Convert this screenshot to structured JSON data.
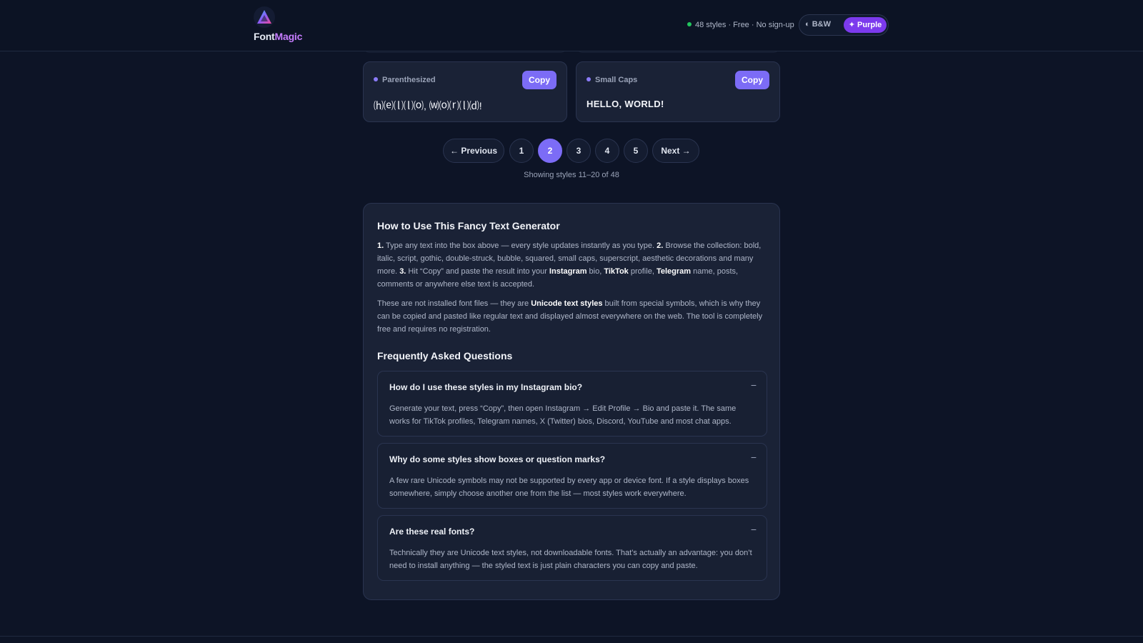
{
  "header": {
    "logo_font": "Font",
    "logo_magic": "Magic",
    "stats": "48 styles · Free · No sign-up",
    "theme_bw": "◐ B&W",
    "theme_purple": "✦ Purple"
  },
  "cards": [
    {
      "label": "Parenthesized",
      "output": "⒣⒠⒧⒧⒪, ⒲⒪⒭⒧⒟!",
      "copy": "Copy"
    },
    {
      "label": "Small Caps",
      "output": "HELLO, WORLD!",
      "copy": "Copy"
    }
  ],
  "pagination": {
    "previous": "← Previous",
    "next": "Next →",
    "pages": [
      "1",
      "2",
      "3",
      "4",
      "5"
    ],
    "active_page": "2",
    "info": "Showing styles 11–20 of 48"
  },
  "howto": {
    "title": "How to Use This Fancy Text Generator",
    "p1": [
      {
        "t": "1.",
        "b": true
      },
      {
        "t": " Type any text into the box above — every style updates instantly as you type. "
      },
      {
        "t": "2.",
        "b": true
      },
      {
        "t": " Browse the collection: bold, italic, script, gothic, double-struck, bubble, squared, small caps, superscript, aesthetic decorations and many more. "
      },
      {
        "t": "3.",
        "b": true
      },
      {
        "t": " Hit “Copy” and paste the result into your "
      },
      {
        "t": "Instagram",
        "b": true
      },
      {
        "t": " bio, "
      },
      {
        "t": "TikTok",
        "b": true
      },
      {
        "t": " profile, "
      },
      {
        "t": "Telegram",
        "b": true
      },
      {
        "t": " name, posts, comments or anywhere else text is accepted."
      }
    ],
    "p2": [
      {
        "t": "These are not installed font files — they are "
      },
      {
        "t": "Unicode text styles",
        "b": true
      },
      {
        "t": " built from special symbols, which is why they can be copied and pasted like regular text and displayed almost everywhere on the web. The tool is completely free and requires no registration."
      }
    ]
  },
  "faq": {
    "title": "Frequently Asked Questions",
    "toggle": "−",
    "items": [
      {
        "q": "How do I use these styles in my Instagram bio?",
        "a": "Generate your text, press “Copy”, then open Instagram → Edit Profile → Bio and paste it. The same works for TikTok profiles, Telegram names, X (Twitter) bios, Discord, YouTube and most chat apps."
      },
      {
        "q": "Why do some styles show boxes or question marks?",
        "a": "A few rare Unicode symbols may not be supported by every app or device font. If a style displays boxes somewhere, simply choose another one from the list — most styles work everywhere."
      },
      {
        "q": "Are these real fonts?",
        "a": "Technically they are Unicode text styles, not downloadable fonts. That’s actually an advantage: you don’t need to install anything — the styled text is just plain characters you can copy and paste."
      }
    ]
  },
  "colors": {
    "background": "#0d1426",
    "card": "#1a2236",
    "accent": "#7c6cf6",
    "purple_theme": "#7c3aed",
    "status_green": "#22c55e"
  }
}
